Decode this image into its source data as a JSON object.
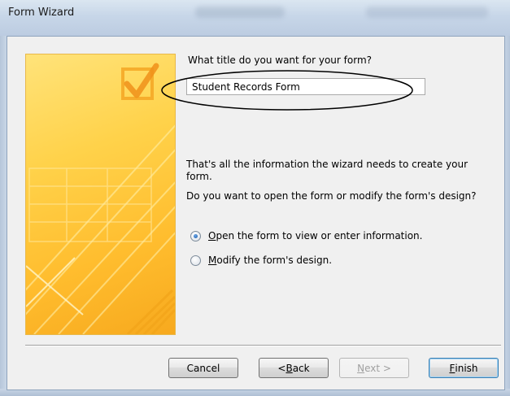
{
  "window": {
    "title": "Form Wizard"
  },
  "form": {
    "title_question": "What title do you want for your form?",
    "title_value": "Student Records Form",
    "info_text": "That's all the information the wizard needs to create your form.",
    "open_question": "Do you want to open the form or modify the form's design?"
  },
  "options": [
    {
      "label_mnemonic": "O",
      "label_rest": "pen the form to view or enter information.",
      "selected": true
    },
    {
      "label_mnemonic": "M",
      "label_rest": "odify the form's design.",
      "selected": false
    }
  ],
  "buttons": {
    "cancel": "Cancel",
    "back_prefix": "< ",
    "back_mnemonic": "B",
    "back_rest": "ack",
    "next_mnemonic": "N",
    "next_rest": "ext >",
    "finish_mnemonic": "F",
    "finish_rest": "inish"
  },
  "colors": {
    "art_orange": "#ffbd2e",
    "accent_blue": "#1b5aa6"
  }
}
